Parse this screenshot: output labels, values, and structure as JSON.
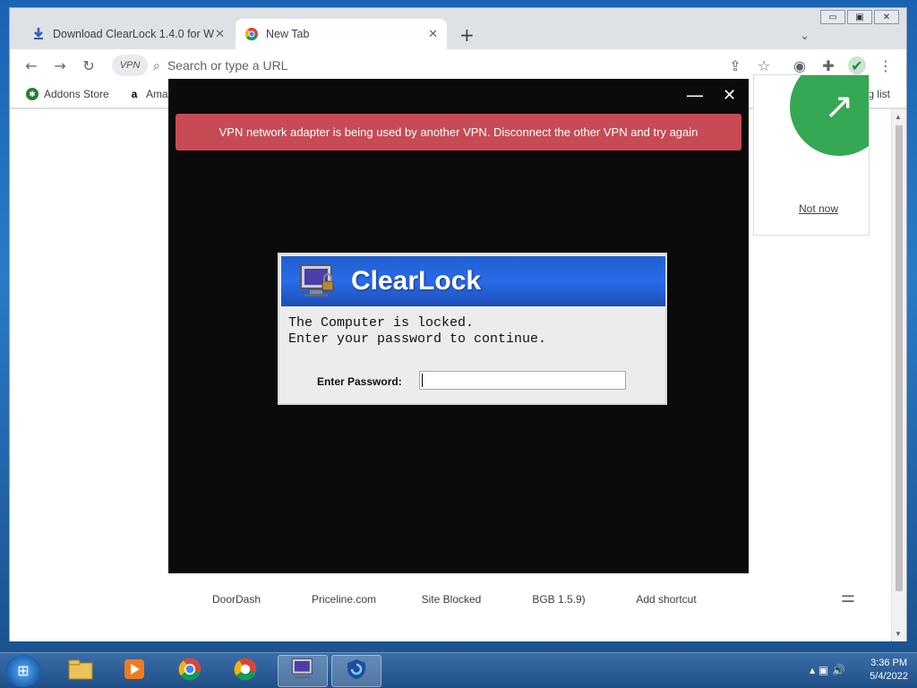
{
  "browser": {
    "tabs": [
      {
        "title": "Download ClearLock 1.4.0 for W",
        "close": "✕"
      },
      {
        "title": "New Tab",
        "close": "✕"
      }
    ],
    "new_tab": "+",
    "omnibox_placeholder": "Search or type a URL",
    "vpn_badge": "VPN",
    "bookmarks": [
      {
        "label": "Addons Store"
      },
      {
        "label": "Ama"
      }
    ],
    "bookmarks_right": "g list",
    "popup_link": "Not now",
    "shortcuts": [
      "DoorDash",
      "Priceline.com",
      "Site Blocked",
      "BGB 1.5.9)",
      "Add shortcut"
    ]
  },
  "vpn_app": {
    "error_message": "VPN network adapter is being used by another VPN. Disconnect the other VPN and try again",
    "minimize": "—",
    "close": "✕"
  },
  "clearlock": {
    "title": "ClearLock",
    "line1": "The Computer is locked.",
    "line2": "Enter your password to continue.",
    "password_label": "Enter Password:",
    "password_value": ""
  },
  "taskbar": {
    "time": "3:36 PM",
    "date": "5/4/2022"
  },
  "colors": {
    "error_bg": "#c74b55",
    "clearlock_header": "#2a6bea",
    "popup_green": "#34a853"
  }
}
